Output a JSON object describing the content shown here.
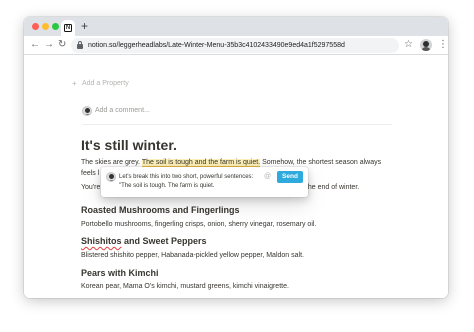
{
  "browser": {
    "url": "notion.so/leggerheadlabs/Late-Winter-Menu-35b3c4102433490e9ed4a1f5297558d",
    "new_tab_label": "+",
    "tab_favicon_letter": "N",
    "icons": {
      "back": "arrow-left-icon",
      "forward": "arrow-right-icon",
      "reload": "reload-icon",
      "lock": "lock-icon",
      "star": "star-icon",
      "menu": "kebab-menu-icon"
    }
  },
  "page": {
    "add_property": "Add a Property",
    "add_comment_placeholder": "Add a comment...",
    "title": "It's still winter.",
    "paragraph": {
      "line1_before": "The skies are grey. ",
      "line1_highlight": "The soil is tough and the farm is quiet.",
      "line1_after": " Somehow, the shortest season always",
      "line2": "feels l",
      "line3_start": "You're",
      "line3_end": "ough the end of winter."
    },
    "sections": [
      {
        "heading": "Roasted Mushrooms and Fingerlings",
        "body": "Portobello mushrooms, fingerling crisps, onion, sherry vinegar, rosemary oil."
      },
      {
        "heading": "Shishitos and Sweet Peppers",
        "heading_misspelled": "Shishitos",
        "heading_rest": " and Sweet Peppers",
        "body": "Blistered shishito pepper, Habanada-pickled yellow pepper, Maldon salt."
      },
      {
        "heading": "Pears with Kimchi",
        "body": "Korean pear, Mama O's kimchi, mustard greens, kimchi vinaigrette."
      }
    ]
  },
  "comment_popover": {
    "text": "Let's break this into two short, powerful sentences: \"The soil is tough. The farm is quiet.",
    "at_label": "@",
    "send_label": "Send"
  },
  "colors": {
    "highlight_bg": "#fdf0b6",
    "highlight_underline": "#e9b949",
    "send_button": "#2eaadc",
    "spellcheck": "#e03e3e",
    "text": "#37352f"
  }
}
